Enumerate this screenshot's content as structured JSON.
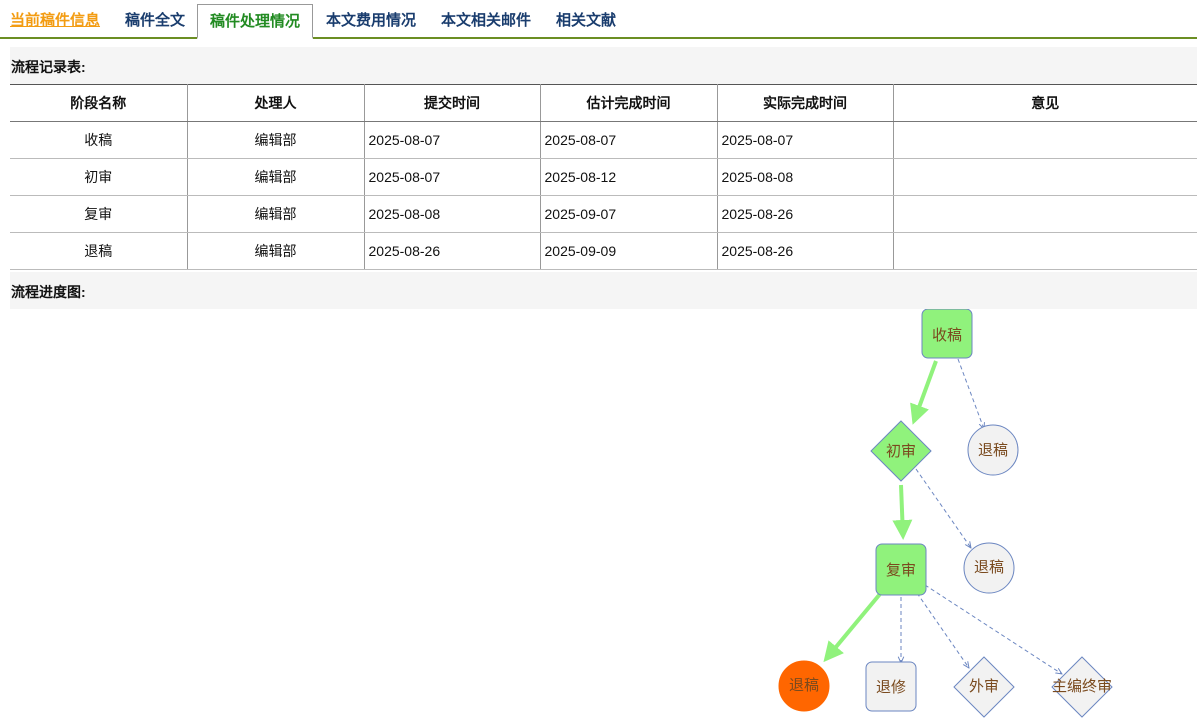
{
  "tabs": [
    {
      "label": "当前稿件信息"
    },
    {
      "label": "稿件全文"
    },
    {
      "label": "稿件处理情况"
    },
    {
      "label": "本文费用情况"
    },
    {
      "label": "本文相关邮件"
    },
    {
      "label": "相关文献"
    }
  ],
  "record": {
    "title": "流程记录表:",
    "columns": [
      "阶段名称",
      "处理人",
      "提交时间",
      "估计完成时间",
      "实际完成时间",
      "意见"
    ],
    "rows": [
      [
        "收稿",
        "编辑部",
        "2025-08-07",
        "2025-08-07",
        "2025-08-07",
        ""
      ],
      [
        "初审",
        "编辑部",
        "2025-08-07",
        "2025-08-12",
        "2025-08-08",
        ""
      ],
      [
        "复审",
        "编辑部",
        "2025-08-08",
        "2025-09-07",
        "2025-08-26",
        ""
      ],
      [
        "退稿",
        "编辑部",
        "2025-08-26",
        "2025-09-09",
        "2025-08-26",
        ""
      ]
    ]
  },
  "progress": {
    "title": "流程进度图:",
    "nodes": [
      {
        "label": "收稿",
        "shape": "rounded-rect",
        "state": "done"
      },
      {
        "label": "退稿",
        "shape": "circle",
        "state": "pending"
      },
      {
        "label": "初审",
        "shape": "diamond",
        "state": "done"
      },
      {
        "label": "退稿",
        "shape": "circle",
        "state": "pending"
      },
      {
        "label": "复审",
        "shape": "rounded-rect",
        "state": "done"
      },
      {
        "label": "退稿",
        "shape": "circle",
        "state": "current"
      },
      {
        "label": "退修",
        "shape": "rounded-rect",
        "state": "pending"
      },
      {
        "label": "外审",
        "shape": "diamond",
        "state": "pending"
      },
      {
        "label": "主编终审",
        "shape": "diamond",
        "state": "pending"
      }
    ],
    "colors": {
      "done_fill": "#90f27c",
      "pending_fill": "#f2f2f2",
      "current_fill": "#ff6600",
      "node_stroke": "#6b86c1",
      "active_edge": "#90f27c",
      "pending_edge": "#6b86c1",
      "label_color": "#7a4a1e",
      "tab_active": "#228b22",
      "tab_link": "#f39c12",
      "tab_normal": "#1a3d6e"
    }
  }
}
